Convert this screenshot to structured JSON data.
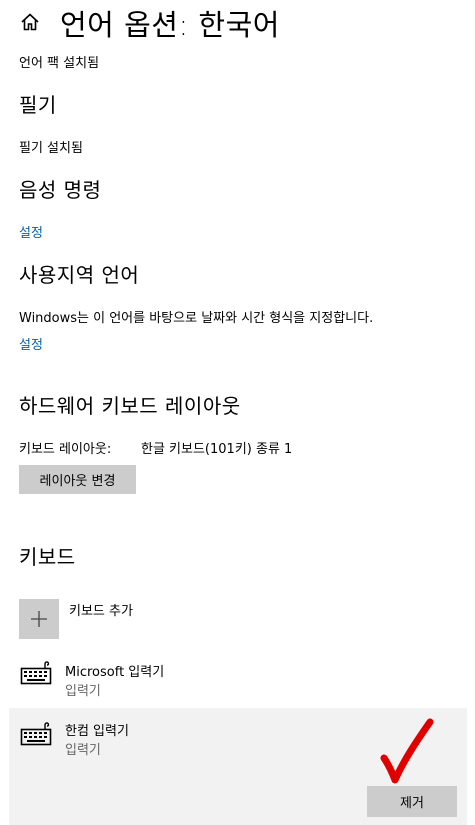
{
  "header": {
    "title": "언어 옵션: 한국어",
    "home_icon": "home-icon"
  },
  "language_pack": {
    "status": "언어 팩 설치됨"
  },
  "handwriting": {
    "heading": "필기",
    "status": "필기 설치됨"
  },
  "voice": {
    "heading": "음성 명령",
    "link": "설정"
  },
  "regional": {
    "heading": "사용지역 언어",
    "description": "Windows는 이 언어를 바탕으로 날짜와 시간 형식을 지정합니다.",
    "link": "설정"
  },
  "hardware_keyboard": {
    "heading": "하드웨어 키보드 레이아웃",
    "label": "키보드 레이아웃:",
    "value": "한글 키보드(101키) 종류 1",
    "button": "레이아웃 변경"
  },
  "keyboards": {
    "heading": "키보드",
    "add_label": "키보드 추가",
    "items": [
      {
        "name": "Microsoft 입력기",
        "type": "입력기"
      },
      {
        "name": "한컴 입력기",
        "type": "입력기"
      }
    ],
    "remove_button": "제거"
  },
  "colors": {
    "link": "#0063b1",
    "button": "#cccccc",
    "selected_bg": "#f2f2f2",
    "annotation": "#e00000"
  }
}
